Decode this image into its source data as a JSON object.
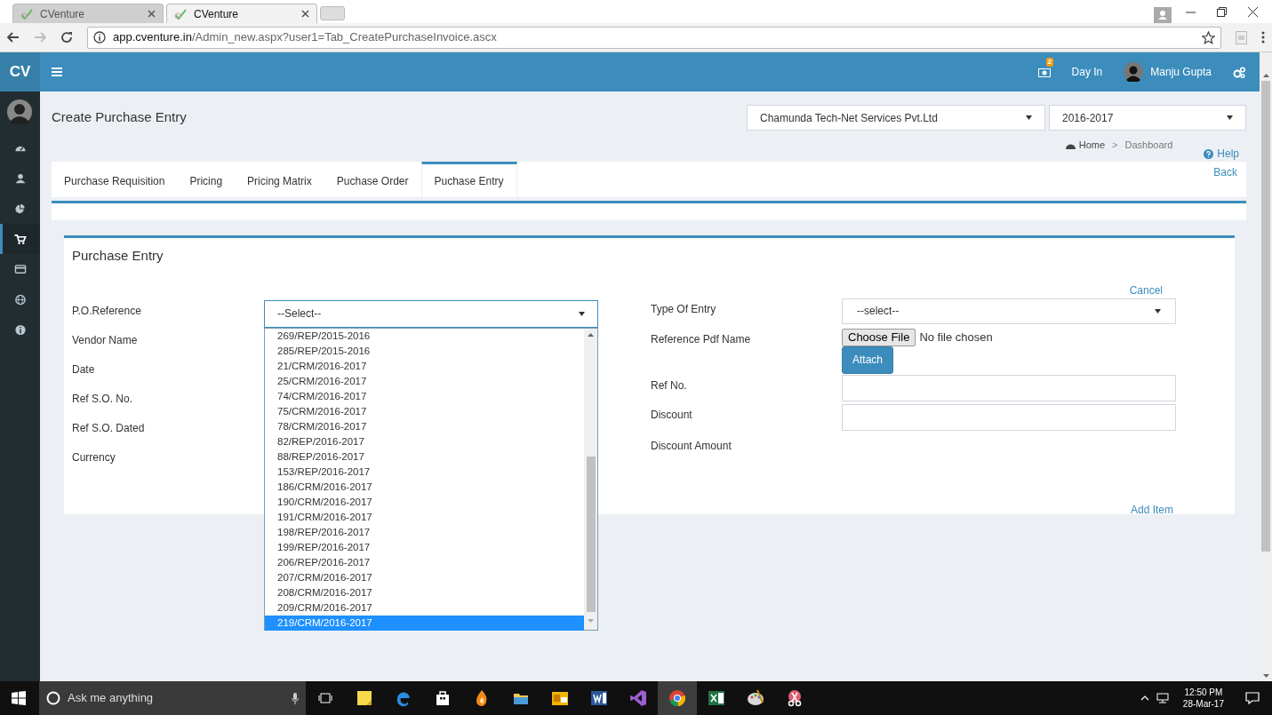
{
  "browser": {
    "tabs": [
      {
        "title": "CVenture",
        "selected": false
      },
      {
        "title": "CVenture",
        "selected": true
      }
    ],
    "address": {
      "host": "app.cventure.in",
      "path": "/Admin_new.aspx?user1=Tab_CreatePurchaseInvoice.ascx"
    }
  },
  "header": {
    "logo": "CV",
    "notification_count": "2",
    "day_in": "Day In",
    "user": "Manju Gupta"
  },
  "sidebar": {
    "items": [
      {
        "kind": "dashboard",
        "selected": false
      },
      {
        "kind": "user",
        "selected": false
      },
      {
        "kind": "pie",
        "selected": false
      },
      {
        "kind": "cart",
        "selected": true
      },
      {
        "kind": "card",
        "selected": false
      },
      {
        "kind": "globe",
        "selected": false
      },
      {
        "kind": "info",
        "selected": false
      }
    ]
  },
  "page": {
    "title": "Create Purchase Entry",
    "company": "Chamunda Tech-Net Services Pvt.Ltd",
    "year": "2016-2017",
    "breadcrumb": [
      "Home",
      "Dashboard"
    ],
    "breadcrumb_separator": ">",
    "help": "Help",
    "back": "Back"
  },
  "tabs": [
    {
      "label": "Purchase Requisition",
      "selected": false
    },
    {
      "label": "Pricing",
      "selected": false
    },
    {
      "label": "Pricing Matrix",
      "selected": false
    },
    {
      "label": "Puchase Order",
      "selected": false
    },
    {
      "label": "Puchase Entry",
      "selected": true
    }
  ],
  "form": {
    "title": "Purchase Entry",
    "cancel": "Cancel",
    "add_item": "Add Item",
    "left_fields": [
      {
        "label": "P.O.Reference",
        "value": "--Select--"
      },
      {
        "label": "Vendor Name"
      },
      {
        "label": "Date"
      },
      {
        "label": "Ref S.O. No."
      },
      {
        "label": "Ref S.O. Dated"
      },
      {
        "label": "Currency"
      }
    ],
    "po_options": [
      {
        "label": "269/REP/2015-2016",
        "selected": false
      },
      {
        "label": "285/REP/2015-2016",
        "selected": false
      },
      {
        "label": "21/CRM/2016-2017",
        "selected": false
      },
      {
        "label": "25/CRM/2016-2017",
        "selected": false
      },
      {
        "label": "74/CRM/2016-2017",
        "selected": false
      },
      {
        "label": "75/CRM/2016-2017",
        "selected": false
      },
      {
        "label": "78/CRM/2016-2017",
        "selected": false
      },
      {
        "label": "82/REP/2016-2017",
        "selected": false
      },
      {
        "label": "88/REP/2016-2017",
        "selected": false
      },
      {
        "label": "153/REP/2016-2017",
        "selected": false
      },
      {
        "label": "186/CRM/2016-2017",
        "selected": false
      },
      {
        "label": "190/CRM/2016-2017",
        "selected": false
      },
      {
        "label": "191/CRM/2016-2017",
        "selected": false
      },
      {
        "label": "198/REP/2016-2017",
        "selected": false
      },
      {
        "label": "199/REP/2016-2017",
        "selected": false
      },
      {
        "label": "206/REP/2016-2017",
        "selected": false
      },
      {
        "label": "207/CRM/2016-2017",
        "selected": false
      },
      {
        "label": "208/CRM/2016-2017",
        "selected": false
      },
      {
        "label": "209/CRM/2016-2017",
        "selected": false
      },
      {
        "label": "219/CRM/2016-2017",
        "selected": true
      }
    ],
    "right_fields": [
      {
        "kind": "select",
        "label": "Type Of Entry",
        "value": "--select--"
      },
      {
        "kind": "file",
        "label": "Reference Pdf Name",
        "button": "Choose File",
        "status": "No file chosen",
        "action": "Attach"
      },
      {
        "kind": "input",
        "label": "Ref No."
      },
      {
        "kind": "input",
        "label": "Discount"
      },
      {
        "kind": "text",
        "label": "Discount Amount"
      }
    ]
  },
  "taskbar": {
    "search_placeholder": "Ask me anything",
    "time": "12:50 PM",
    "date": "28-Mar-17",
    "apps": [
      {
        "kind": "notes",
        "selected": false
      },
      {
        "kind": "edge",
        "selected": false
      },
      {
        "kind": "store",
        "selected": false
      },
      {
        "kind": "flame",
        "selected": false
      },
      {
        "kind": "folder",
        "selected": false
      },
      {
        "kind": "outlook",
        "selected": false
      },
      {
        "kind": "word",
        "selected": false
      },
      {
        "kind": "studio",
        "selected": false
      },
      {
        "kind": "chrome",
        "selected": true
      },
      {
        "kind": "excel",
        "selected": false
      },
      {
        "kind": "paint",
        "selected": false
      },
      {
        "kind": "snip",
        "selected": false
      }
    ]
  }
}
